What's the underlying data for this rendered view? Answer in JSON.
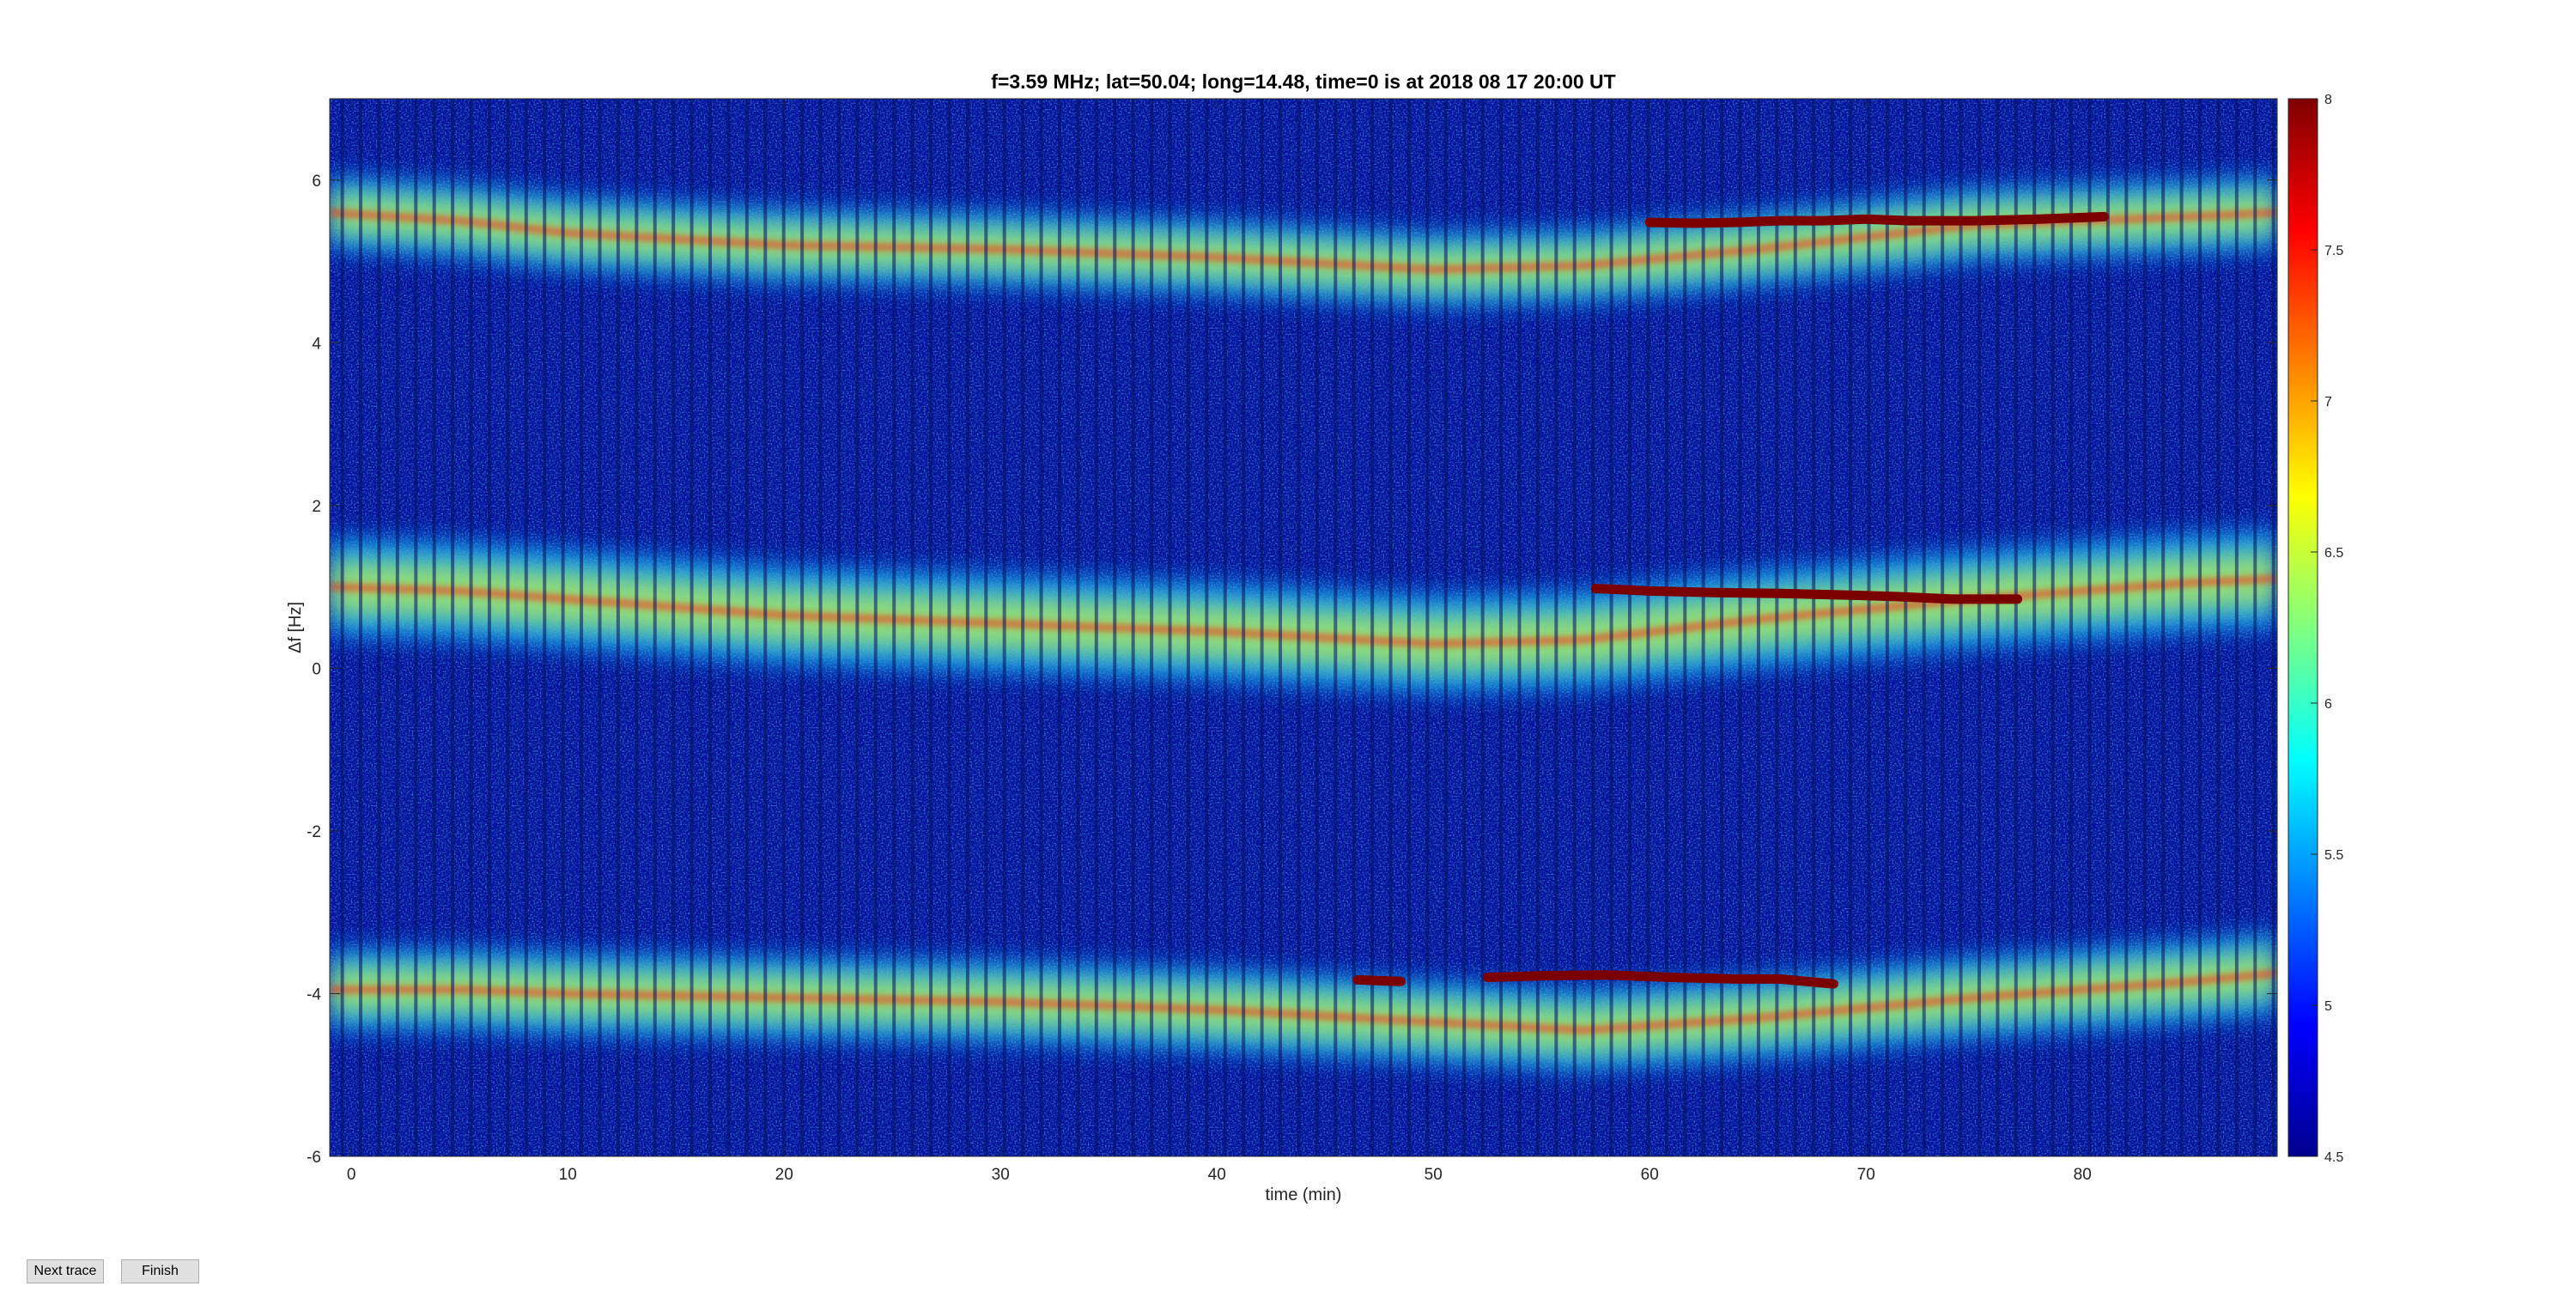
{
  "controls": {
    "next_trace_label": "Next trace",
    "finish_label": "Finish"
  },
  "chart_data": {
    "type": "heatmap",
    "title": "f=3.59 MHz;  lat=50.04; long=14.48, time=0 is at 2018 08 17 20:00 UT",
    "xlabel": "time (min)",
    "ylabel": "Δf [Hz]",
    "xlim": [
      -1,
      89
    ],
    "ylim": [
      -6,
      7
    ],
    "x_ticks": [
      0,
      10,
      20,
      30,
      40,
      50,
      60,
      70,
      80
    ],
    "y_ticks": [
      -6,
      -4,
      -2,
      0,
      2,
      4,
      6
    ],
    "colorbar": {
      "limits": [
        4.5,
        8
      ],
      "ticks": [
        4.5,
        5,
        5.5,
        6,
        6.5,
        7,
        7.5,
        8
      ],
      "tick_labels": [
        "4.5",
        "5",
        "5.5",
        "6",
        "6.5",
        "7",
        "7.5",
        "8"
      ],
      "colormap": "jet"
    },
    "grid": false,
    "bands": [
      {
        "name": "",
        "x": [
          -1,
          5,
          10,
          20,
          30,
          40,
          50,
          57,
          65,
          75,
          85,
          89
        ],
        "y": [
          5.6,
          5.5,
          5.35,
          5.2,
          5.15,
          5.05,
          4.9,
          4.95,
          5.15,
          5.45,
          5.55,
          5.6
        ],
        "width": 0.45
      },
      {
        "name": "",
        "x": [
          -1,
          5,
          10,
          20,
          30,
          40,
          50,
          57,
          65,
          75,
          85,
          89
        ],
        "y": [
          1.0,
          0.95,
          0.85,
          0.65,
          0.55,
          0.45,
          0.3,
          0.35,
          0.6,
          0.85,
          1.05,
          1.1
        ],
        "width": 0.6
      },
      {
        "name": "",
        "x": [
          -1,
          5,
          10,
          20,
          30,
          40,
          50,
          57,
          65,
          75,
          85,
          89
        ],
        "y": [
          -3.95,
          -3.95,
          -4.0,
          -4.05,
          -4.1,
          -4.2,
          -4.35,
          -4.45,
          -4.3,
          -4.05,
          -3.85,
          -3.75
        ],
        "width": 0.5
      }
    ],
    "strong_traces": [
      {
        "x": [
          60,
          62,
          64,
          66,
          68,
          70,
          72,
          75,
          78,
          81
        ],
        "y": [
          5.48,
          5.47,
          5.48,
          5.5,
          5.5,
          5.52,
          5.5,
          5.5,
          5.52,
          5.55
        ]
      },
      {
        "x": [
          57.5,
          60,
          63,
          66,
          69,
          71.5,
          74,
          77
        ],
        "y": [
          0.98,
          0.95,
          0.93,
          0.92,
          0.9,
          0.88,
          0.85,
          0.85
        ]
      },
      {
        "x": [
          46.5,
          48.5
        ],
        "y": [
          -3.83,
          -3.85
        ]
      },
      {
        "x": [
          52.5,
          55,
          58,
          61,
          64,
          66,
          68.5
        ],
        "y": [
          -3.8,
          -3.78,
          -3.77,
          -3.8,
          -3.82,
          -3.82,
          -3.88
        ]
      }
    ]
  }
}
